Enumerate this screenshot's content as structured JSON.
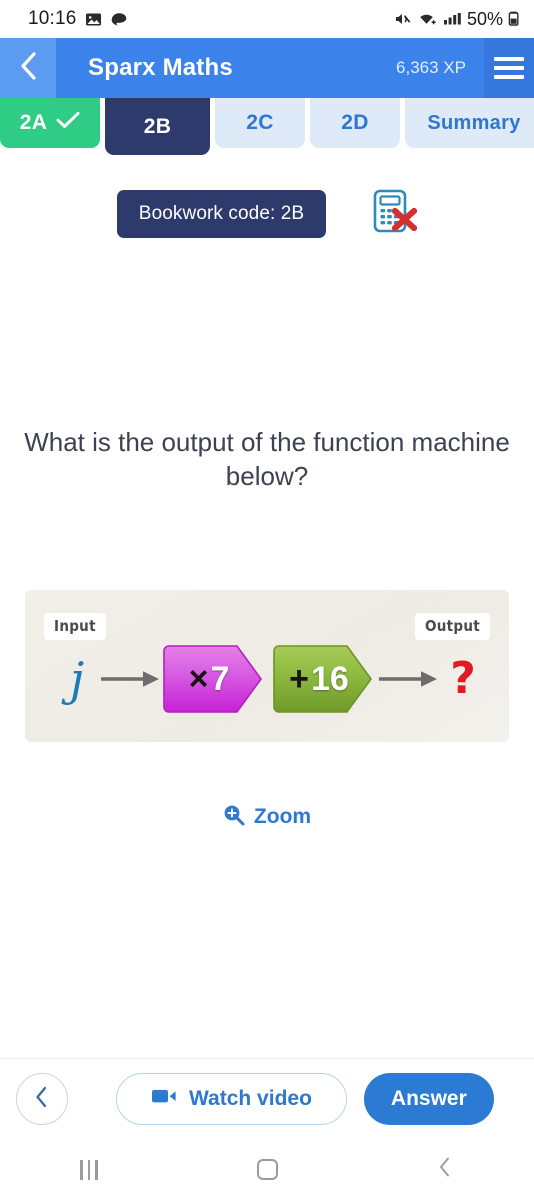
{
  "status_bar": {
    "time": "10:16",
    "icons_left": [
      "image-icon",
      "app-icon"
    ],
    "icons_right": [
      "mute-icon",
      "wifi-icon",
      "signal-icon"
    ],
    "battery_text": "50%",
    "battery_icon": "battery-icon"
  },
  "header": {
    "back_icon": "chevron-left-icon",
    "title": "Sparx Maths",
    "xp": "6,363 XP",
    "menu_icon": "hamburger-menu-icon"
  },
  "tabs": [
    {
      "label": "2A",
      "state": "completed",
      "check_icon": "check-icon"
    },
    {
      "label": "2B",
      "state": "active"
    },
    {
      "label": "2C",
      "state": "idle"
    },
    {
      "label": "2D",
      "state": "idle"
    },
    {
      "label": "Summary",
      "state": "idle"
    }
  ],
  "bookwork": {
    "code_label": "Bookwork code: 2B",
    "no_calculator_icon": "no-calculator-icon"
  },
  "question": {
    "text": "What is the output of the function machine below?"
  },
  "function_machine": {
    "input_label": "Input",
    "output_label": "Output",
    "input_variable": "j",
    "output_value": "?",
    "steps": [
      {
        "operator": "×",
        "number": "7",
        "color": "#d633e0"
      },
      {
        "operator": "+",
        "number": "16",
        "color": "#86b43a"
      }
    ],
    "arrow_icon": "arrow-right-icon"
  },
  "zoom_link": {
    "label": "Zoom",
    "icon": "magnifier-plus-icon"
  },
  "actions": {
    "back_icon": "chevron-left-icon",
    "watch_video_label": "Watch video",
    "video_icon": "video-camera-icon",
    "answer_label": "Answer"
  },
  "android_nav": {
    "recents_icon": "recents-icon",
    "home_icon": "home-icon",
    "back_icon": "nav-back-icon"
  },
  "colors": {
    "header_blue": "#3b82ea",
    "active_tab_navy": "#2d3a6b",
    "completed_tab_green": "#2ecc84",
    "idle_tab_blue": "#dfeaf8",
    "accent_blue": "#2e78d2",
    "answer_blue": "#2b7ad4",
    "question_mark_red": "#e01b22",
    "panel_beige": "#f1eee7"
  }
}
